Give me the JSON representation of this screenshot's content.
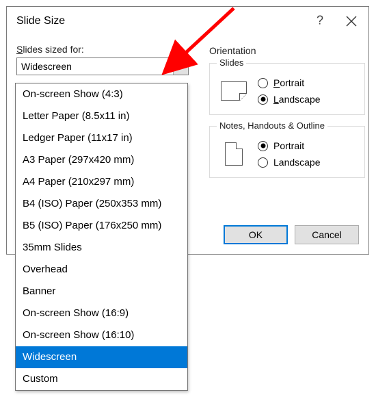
{
  "dialog": {
    "title": "Slide Size"
  },
  "fields": {
    "slides_sized_for_label_prefix_u": "S",
    "slides_sized_for_label_suffix": "lides sized for:"
  },
  "combo": {
    "selected": "Widescreen"
  },
  "dropdown": {
    "items": [
      "On-screen Show (4:3)",
      "Letter Paper (8.5x11 in)",
      "Ledger Paper (11x17 in)",
      "A3 Paper (297x420 mm)",
      "A4 Paper (210x297 mm)",
      "B4 (ISO) Paper (250x353 mm)",
      "B5 (ISO) Paper (176x250 mm)",
      "35mm Slides",
      "Overhead",
      "Banner",
      "On-screen Show (16:9)",
      "On-screen Show (16:10)",
      "Widescreen",
      "Custom"
    ],
    "selected_index": 12
  },
  "orientation": {
    "label": "Orientation",
    "slides_legend": "Slides",
    "notes_legend": "Notes, Handouts & Outline",
    "portrait_u": "P",
    "portrait_rest": "ortrait",
    "landscape_u": "L",
    "landscape_rest": "andscape",
    "portrait2": "Portrait",
    "landscape2": "Landscape"
  },
  "buttons": {
    "ok": "OK",
    "cancel": "Cancel"
  },
  "annotation": {
    "arrow_color": "#ff0000"
  }
}
